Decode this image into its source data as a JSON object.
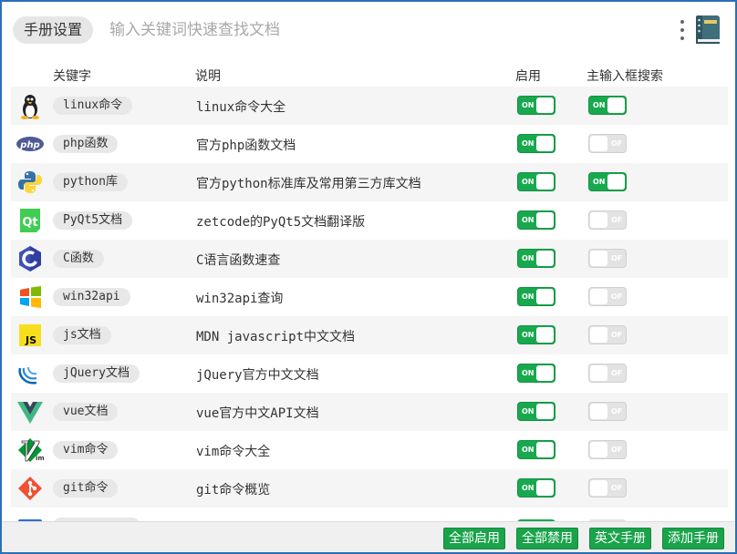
{
  "header": {
    "title": "手册设置",
    "search_placeholder": "输入关键词快速查找文档"
  },
  "columns": {
    "keyword": "关键字",
    "description": "说明",
    "enabled": "启用",
    "main_search": "主输入框搜索"
  },
  "toggle_labels": {
    "on": "ON",
    "off": "OF"
  },
  "rows": [
    {
      "icon": "linux-icon",
      "keyword": "linux命令",
      "description": "linux命令大全",
      "enabled": true,
      "main_search": true
    },
    {
      "icon": "php-icon",
      "keyword": "php函数",
      "description": "官方php函数文档",
      "enabled": true,
      "main_search": false
    },
    {
      "icon": "python-icon",
      "keyword": "python库",
      "description": "官方python标准库及常用第三方库文档",
      "enabled": true,
      "main_search": true
    },
    {
      "icon": "qt-icon",
      "keyword": "PyQt5文档",
      "description": "zetcode的PyQt5文档翻译版",
      "enabled": true,
      "main_search": false
    },
    {
      "icon": "c-lang-icon",
      "keyword": "C函数",
      "description": "C语言函数速查",
      "enabled": true,
      "main_search": false
    },
    {
      "icon": "windows-icon",
      "keyword": "win32api",
      "description": "win32api查询",
      "enabled": true,
      "main_search": false
    },
    {
      "icon": "javascript-icon",
      "keyword": "js文档",
      "description": "MDN javascript中文文档",
      "enabled": true,
      "main_search": false
    },
    {
      "icon": "jquery-icon",
      "keyword": "jQuery文档",
      "description": "jQuery官方中文文档",
      "enabled": true,
      "main_search": false
    },
    {
      "icon": "vue-icon",
      "keyword": "vue文档",
      "description": "vue官方中文API文档",
      "enabled": true,
      "main_search": false
    },
    {
      "icon": "vim-icon",
      "keyword": "vim命令",
      "description": "vim命令大全",
      "enabled": true,
      "main_search": false
    },
    {
      "icon": "git-icon",
      "keyword": "git命令",
      "description": "git命令概览",
      "enabled": true,
      "main_search": false
    }
  ],
  "footer": {
    "enable_all": "全部启用",
    "disable_all": "全部禁用",
    "english_manual": "英文手册",
    "add_manual": "添加手册"
  },
  "colors": {
    "accent_green": "#18a94f",
    "window_border": "#2c6fb5",
    "row_alt": "#f5f5f5"
  }
}
